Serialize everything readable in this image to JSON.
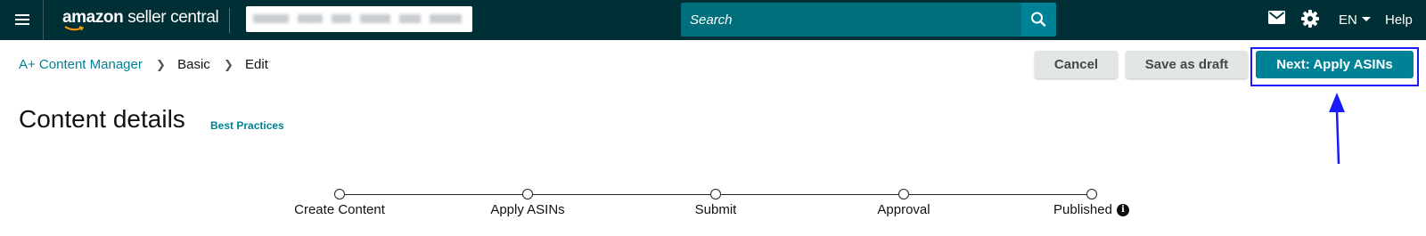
{
  "header": {
    "logo_text_bold": "amazon",
    "logo_text_regular": " seller central",
    "search_placeholder": "Search",
    "language": "EN",
    "help": "Help",
    "icons": {
      "menu": "hamburger-menu-icon",
      "search": "search-icon",
      "mail": "mail-icon",
      "settings": "gear-icon"
    }
  },
  "breadcrumb": {
    "items": [
      "A+ Content Manager",
      "Basic",
      "Edit"
    ]
  },
  "actions": {
    "cancel": "Cancel",
    "save_draft": "Save as draft",
    "next": "Next: Apply ASINs"
  },
  "page": {
    "title": "Content details",
    "best_practices": "Best Practices"
  },
  "stepper": {
    "steps": [
      "Create Content",
      "Apply ASINs",
      "Submit",
      "Approval",
      "Published"
    ]
  },
  "colors": {
    "topbar": "#002f36",
    "search_field": "#006e7b",
    "accent": "#008296",
    "highlight": "#1a1aff"
  }
}
